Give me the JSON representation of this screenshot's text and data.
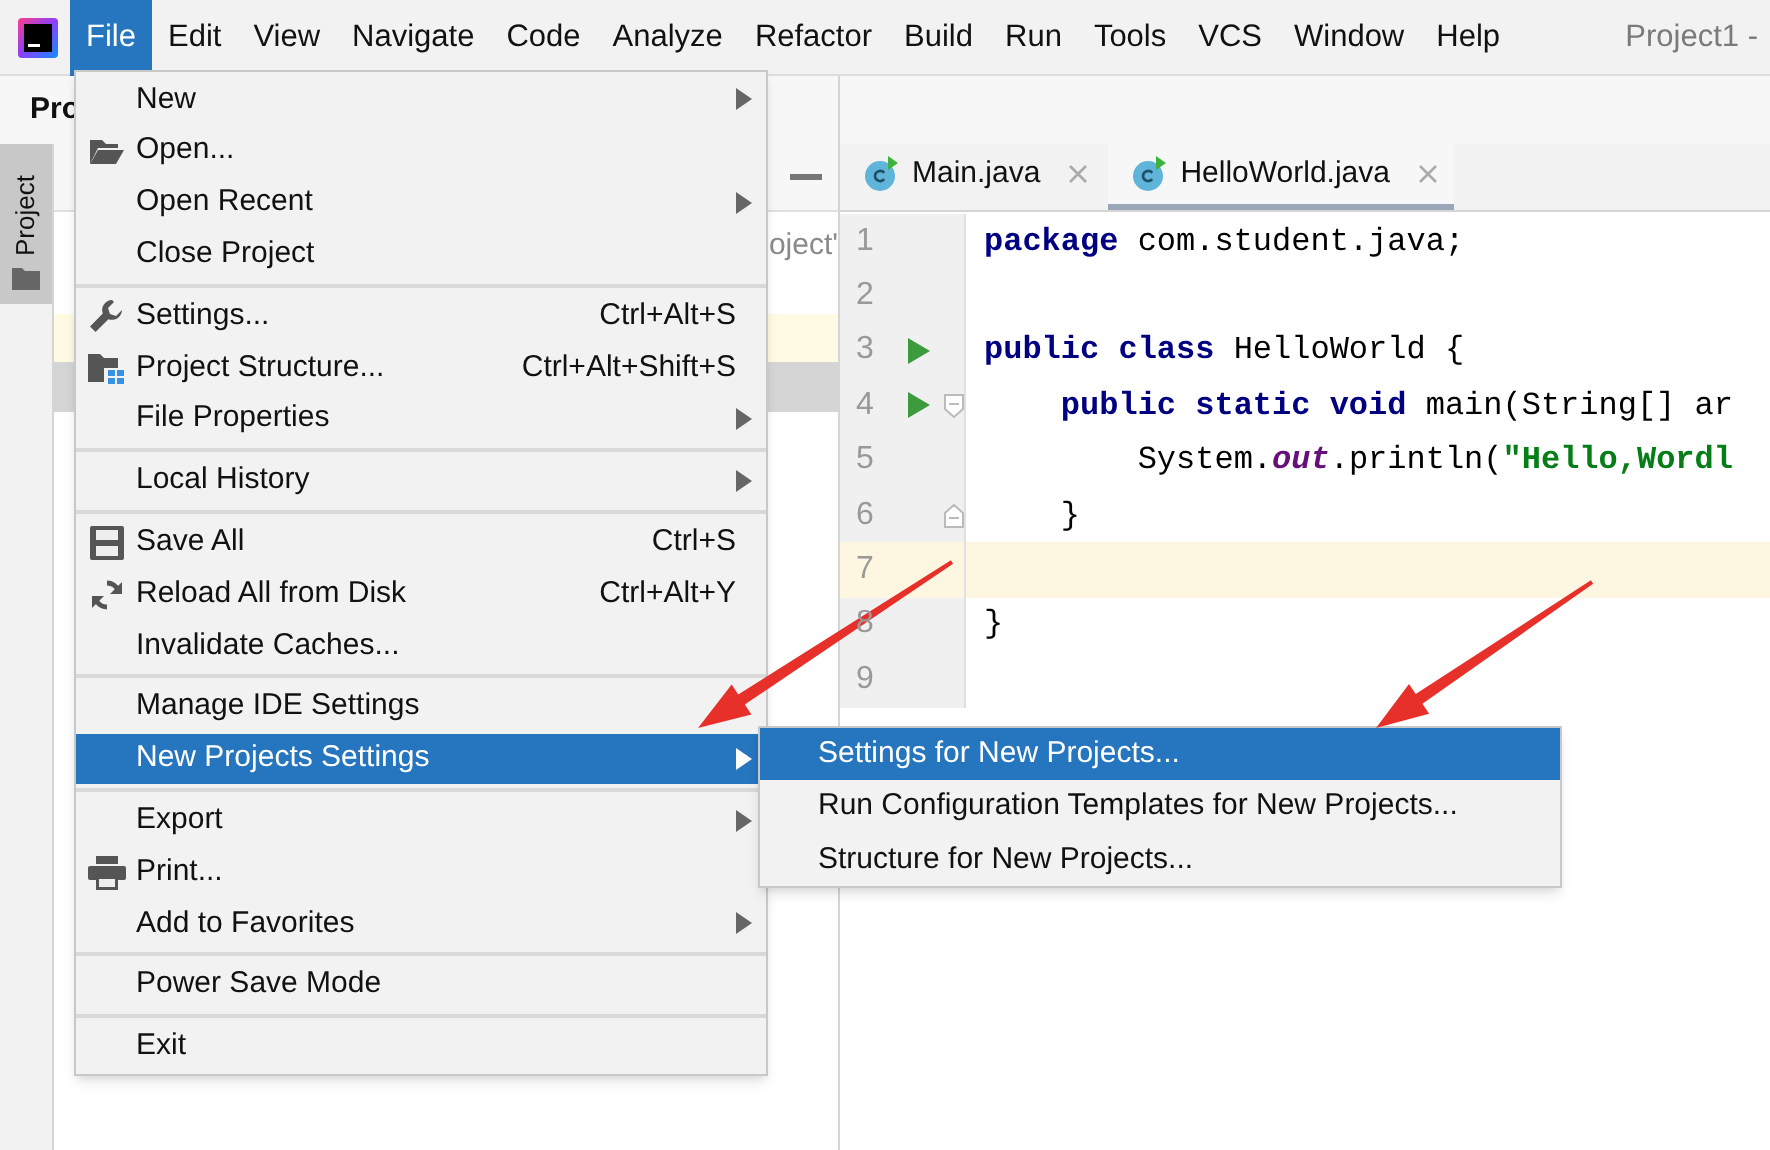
{
  "menu_bar": {
    "items": [
      {
        "label": "File",
        "selected": true
      },
      {
        "label": "Edit",
        "selected": false
      },
      {
        "label": "View",
        "selected": false
      },
      {
        "label": "Navigate",
        "selected": false
      },
      {
        "label": "Code",
        "selected": false
      },
      {
        "label": "Analyze",
        "selected": false
      },
      {
        "label": "Refactor",
        "selected": false
      },
      {
        "label": "Build",
        "selected": false
      },
      {
        "label": "Run",
        "selected": false
      },
      {
        "label": "Tools",
        "selected": false
      },
      {
        "label": "VCS",
        "selected": false
      },
      {
        "label": "Window",
        "selected": false
      },
      {
        "label": "Help",
        "selected": false
      }
    ],
    "title": "Project1 -"
  },
  "project_panel": {
    "header": "Pro",
    "tool_tab": {
      "label": "Project",
      "selected": true
    },
    "tree_text": "oject'"
  },
  "editor": {
    "tabs": [
      {
        "label": "Main.java",
        "selected": false
      },
      {
        "label": "HelloWorld.java",
        "selected": true
      }
    ],
    "lines": [
      {
        "number": "1",
        "current": false,
        "run": false,
        "fold_start": false,
        "fold_end": false,
        "tokens": [
          {
            "kind": "keyword",
            "text": "package"
          },
          {
            "kind": "plain",
            "text": " com.student.java;"
          }
        ]
      },
      {
        "number": "2",
        "current": false,
        "run": false,
        "fold_start": false,
        "fold_end": false
      },
      {
        "number": "3",
        "current": false,
        "run": true,
        "fold_start": false,
        "fold_end": false,
        "tokens": [
          {
            "kind": "keyword",
            "text": "public class"
          },
          {
            "kind": "plain",
            "text": " HelloWorld {"
          }
        ]
      },
      {
        "number": "4",
        "current": false,
        "run": true,
        "fold_start": true,
        "fold_end": false,
        "tokens": [
          {
            "kind": "keyword",
            "text": "    public static void"
          },
          {
            "kind": "plain",
            "text": " main(String[] ar"
          }
        ]
      },
      {
        "number": "5",
        "current": false,
        "run": false,
        "fold_start": false,
        "fold_end": false,
        "tokens": [
          {
            "kind": "plain",
            "text": "        System."
          },
          {
            "kind": "field",
            "text": "out"
          },
          {
            "kind": "plain",
            "text": ".println("
          },
          {
            "kind": "string",
            "text": "\"Hello,Wordl"
          }
        ]
      },
      {
        "number": "6",
        "current": false,
        "run": false,
        "fold_start": false,
        "fold_end": true,
        "tokens": [
          {
            "kind": "plain",
            "text": "    }"
          }
        ]
      },
      {
        "number": "7",
        "current": true,
        "run": false,
        "fold_start": false,
        "fold_end": false
      },
      {
        "number": "8",
        "current": false,
        "run": false,
        "fold_start": false,
        "fold_end": false,
        "tokens": [
          {
            "kind": "plain",
            "text": "}"
          }
        ]
      },
      {
        "number": "9",
        "current": false,
        "run": false,
        "fold_start": false,
        "fold_end": false
      }
    ]
  },
  "file_menu": {
    "groups": [
      [
        {
          "label": "New",
          "submenu": true,
          "highlighted": false
        },
        {
          "label": "Open...",
          "submenu": false,
          "highlighted": false
        },
        {
          "label": "Open Recent",
          "submenu": true,
          "highlighted": false
        },
        {
          "label": "Close Project",
          "submenu": false,
          "highlighted": false
        }
      ],
      [
        {
          "label": "Settings...",
          "shortcut": "Ctrl+Alt+S",
          "submenu": false,
          "highlighted": false
        },
        {
          "label": "Project Structure...",
          "shortcut": "Ctrl+Alt+Shift+S",
          "submenu": false,
          "highlighted": false
        },
        {
          "label": "File Properties",
          "submenu": true,
          "highlighted": false
        }
      ],
      [
        {
          "label": "Local History",
          "submenu": true,
          "highlighted": false
        }
      ],
      [
        {
          "label": "Save All",
          "shortcut": "Ctrl+S",
          "submenu": false,
          "highlighted": false
        },
        {
          "label": "Reload All from Disk",
          "shortcut": "Ctrl+Alt+Y",
          "submenu": false,
          "highlighted": false
        },
        {
          "label": "Invalidate Caches...",
          "submenu": false,
          "highlighted": false
        }
      ],
      [
        {
          "label": "Manage IDE Settings",
          "submenu": false,
          "highlighted": false
        },
        {
          "label": "New Projects Settings",
          "submenu": true,
          "highlighted": true
        }
      ],
      [
        {
          "label": "Export",
          "submenu": true,
          "highlighted": false
        },
        {
          "label": "Print...",
          "submenu": false,
          "highlighted": false
        },
        {
          "label": "Add to Favorites",
          "submenu": true,
          "highlighted": false
        }
      ],
      [
        {
          "label": "Power Save Mode",
          "submenu": false,
          "highlighted": false
        }
      ],
      [
        {
          "label": "Exit",
          "submenu": false,
          "highlighted": false
        }
      ]
    ]
  },
  "submenu": {
    "items": [
      {
        "label": "Settings for New Projects...",
        "highlighted": true
      },
      {
        "label": "Run Configuration Templates for New Projects...",
        "highlighted": false
      },
      {
        "label": "Structure for New Projects...",
        "highlighted": false
      }
    ]
  }
}
